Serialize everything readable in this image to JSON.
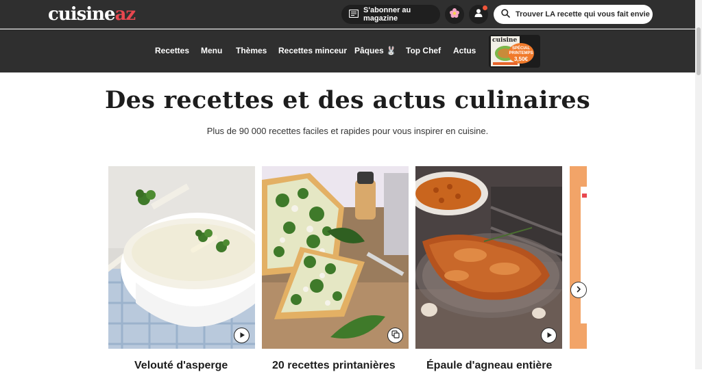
{
  "header": {
    "logo_main": "cuisine",
    "logo_accent": "az",
    "subscribe_label": "S'abonner au magazine",
    "search_placeholder": "Trouver LA recette qui vous fait envie"
  },
  "nav": {
    "items": [
      "Recettes",
      "Menu",
      "Thèmes",
      "Recettes minceur",
      "Pâques 🐰",
      "Top Chef",
      "Actus"
    ]
  },
  "magazine_promo": {
    "cover_title": "cuisine",
    "badge_line1": "SPÉCIAL",
    "badge_line2": "PRINTEMPS",
    "price": "3,50€"
  },
  "hero": {
    "title": "Des recettes et des actus culinaires",
    "subtitle": "Plus de 90 000 recettes faciles et rapides pour vous inspirer en cuisine."
  },
  "carousel": {
    "cards": [
      {
        "title": "Velouté d'asperge",
        "media": "video"
      },
      {
        "title": "20 recettes printanières",
        "media": "gallery"
      },
      {
        "title": "Épaule d'agneau entière",
        "media": "video"
      }
    ]
  },
  "colors": {
    "header_bg": "#2f2f2f",
    "accent": "#e8474f",
    "notification": "#f0553a"
  }
}
